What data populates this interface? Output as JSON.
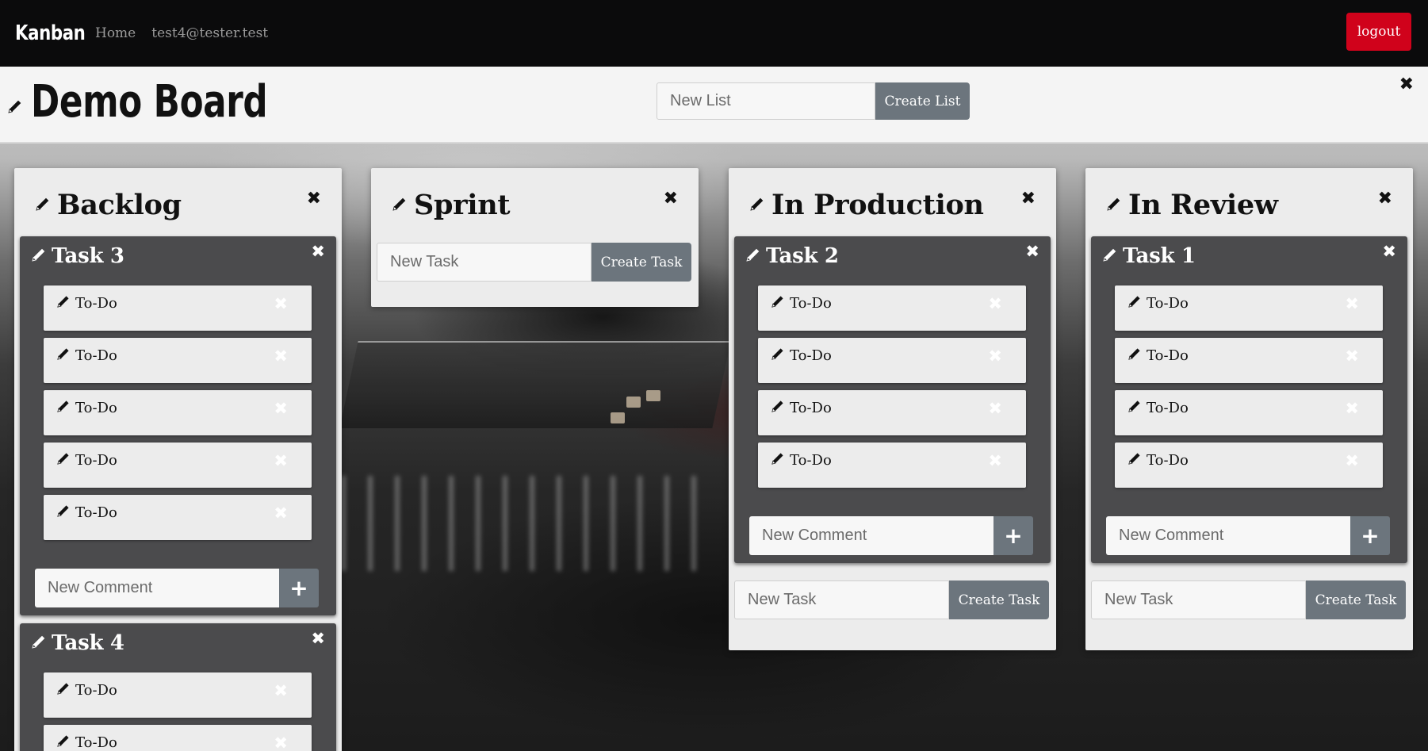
{
  "navbar": {
    "brand": "Kanban",
    "links": [
      "Home",
      "test4@tester.test"
    ],
    "logout_label": "logout"
  },
  "board": {
    "title": "Demo Board",
    "new_list_placeholder": "New List",
    "create_list_label": "Create List"
  },
  "labels": {
    "new_task_placeholder": "New Task",
    "create_task_label": "Create Task",
    "new_comment_placeholder": "New Comment",
    "close_glyph": "✖",
    "plus_glyph": "+"
  },
  "lists": [
    {
      "title": "Backlog",
      "tasks": [
        {
          "title": "Task 3",
          "todos": [
            "To-Do",
            "To-Do",
            "To-Do",
            "To-Do",
            "To-Do"
          ]
        },
        {
          "title": "Task 4",
          "todos": [
            "To-Do",
            "To-Do"
          ]
        }
      ]
    },
    {
      "title": "Sprint",
      "tasks": []
    },
    {
      "title": "In Production",
      "tasks": [
        {
          "title": "Task 2",
          "todos": [
            "To-Do",
            "To-Do",
            "To-Do",
            "To-Do"
          ]
        }
      ]
    },
    {
      "title": "In Review",
      "tasks": [
        {
          "title": "Task 1",
          "todos": [
            "To-Do",
            "To-Do",
            "To-Do",
            "To-Do"
          ]
        }
      ]
    }
  ]
}
